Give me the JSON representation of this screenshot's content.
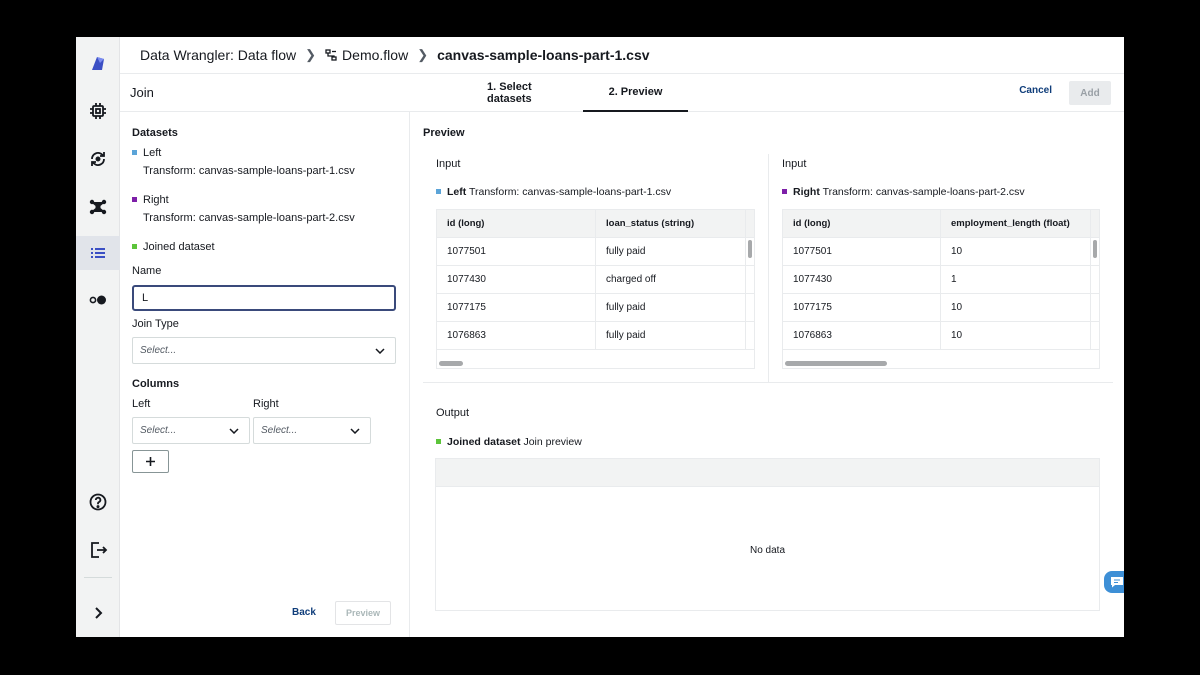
{
  "header": {
    "app": "Data Wrangler: Data flow",
    "flow": "Demo.flow",
    "current": "canvas-sample-loans-part-1.csv"
  },
  "join_bar": {
    "title": "Join",
    "tabs": [
      {
        "label": "1. Select datasets",
        "active": false
      },
      {
        "label": "2. Preview",
        "active": true
      }
    ],
    "cancel": "Cancel",
    "add": "Add"
  },
  "config": {
    "datasets_heading": "Datasets",
    "left_label": "Left",
    "left_desc": "Transform: canvas-sample-loans-part-1.csv",
    "right_label": "Right",
    "right_desc": "Transform: canvas-sample-loans-part-2.csv",
    "joined_label": "Joined dataset",
    "name_label": "Name",
    "name_value": "L",
    "join_type_label": "Join Type",
    "join_type_placeholder": "Select...",
    "columns_heading": "Columns",
    "columns_left_label": "Left",
    "columns_right_label": "Right",
    "left_col_placeholder": "Select...",
    "right_col_placeholder": "Select...",
    "add_icon": "plus-icon",
    "back": "Back",
    "preview": "Preview"
  },
  "preview": {
    "heading": "Preview",
    "left": {
      "input_label": "Input",
      "name": "Left",
      "desc": "Transform: canvas-sample-loans-part-1.csv",
      "columns": [
        "id (long)",
        "loan_status (string)"
      ],
      "rows": [
        [
          "1077501",
          "fully paid"
        ],
        [
          "1077430",
          "charged off"
        ],
        [
          "1077175",
          "fully paid"
        ],
        [
          "1076863",
          "fully paid"
        ]
      ]
    },
    "right": {
      "input_label": "Input",
      "name": "Right",
      "desc": "Transform: canvas-sample-loans-part-2.csv",
      "columns": [
        "id (long)",
        "employment_length (float)"
      ],
      "rows": [
        [
          "1077501",
          "10"
        ],
        [
          "1077430",
          "1"
        ],
        [
          "1077175",
          "10"
        ],
        [
          "1076863",
          "10"
        ]
      ]
    },
    "output": {
      "label": "Output",
      "name": "Joined dataset",
      "desc": "Join preview",
      "empty": "No data"
    }
  },
  "colors": {
    "left": "#5ba4d8",
    "right": "#7d1fa8",
    "joined": "#5cc43a",
    "accent": "#0f3d7a"
  },
  "rail_icons": [
    "data-wrangler-logo-icon",
    "chip-icon",
    "refresh-icon",
    "network-icon",
    "list-icon",
    "toggle-icon",
    "help-icon",
    "sign-out-icon",
    "chevron-right-icon"
  ]
}
